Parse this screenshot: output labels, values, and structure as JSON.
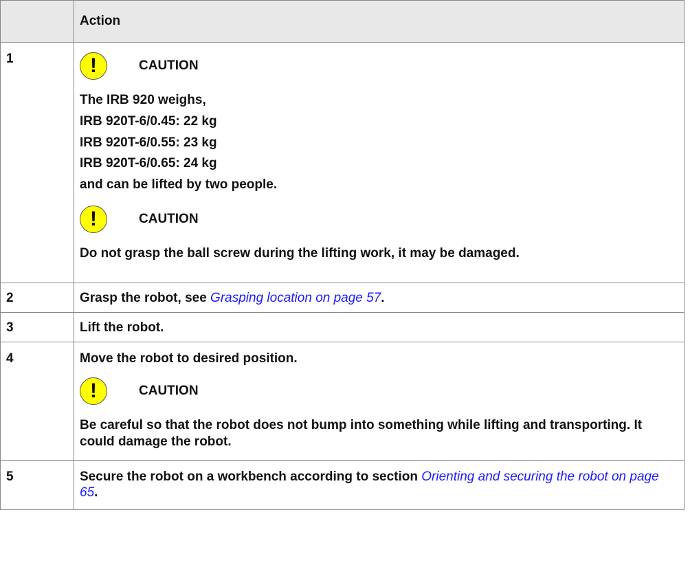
{
  "header": {
    "col1": "",
    "col2": "Action"
  },
  "rows": [
    {
      "num": "1",
      "caution1": "CAUTION",
      "weight_lines": [
        "The IRB 920 weighs,",
        "IRB 920T-6/0.45: 22 kg",
        "IRB 920T-6/0.55: 23 kg",
        "IRB 920T-6/0.65: 24 kg",
        "and can be lifted by two people."
      ],
      "caution2": "CAUTION",
      "warning_text": "Do not grasp the ball screw during the lifting work, it may be damaged."
    },
    {
      "num": "2",
      "text_before": "Grasp the robot, see ",
      "link": "Grasping location on page 57",
      "text_after": "."
    },
    {
      "num": "3",
      "text": "Lift the robot."
    },
    {
      "num": "4",
      "text": "Move the robot to desired position.",
      "caution": "CAUTION",
      "caution_text": "Be careful so that the robot does not bump into something while lifting and transporting. It could damage the robot."
    },
    {
      "num": "5",
      "text_before": "Secure the robot on a workbench according to section ",
      "link": "Orienting and securing the robot on page 65",
      "text_after": "."
    }
  ],
  "icons": {
    "caution": "caution-exclamation-icon",
    "caution_color": "#ffff00",
    "link_color": "#1a1aff"
  },
  "caution_glyph": "!"
}
